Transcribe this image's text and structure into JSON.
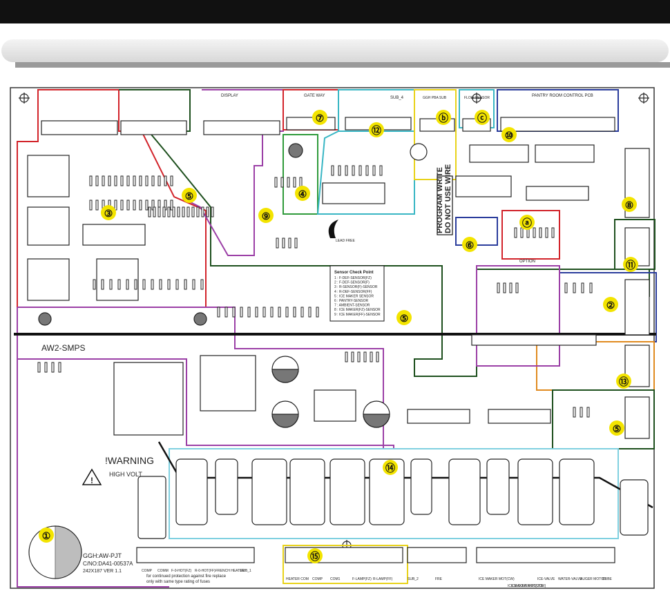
{
  "board": {
    "smps_label": "AW2-SMPS",
    "warning_title": "!WARNING",
    "warning_sub": "HIGH VOLT",
    "part_no": "GGH:AW-PJT",
    "code": "C/NO:DA41-00537A",
    "version": "242X187  VER 1.1",
    "fuse_note_1": "for continued protection against fire replace",
    "fuse_note_2": "only with same type rating of fuses",
    "program_write_1": "PROGRAM WRITE",
    "program_write_2": "DO NOT USE WIRE",
    "lead_free": "LEAD FREE",
    "option_label": "OPTION",
    "sensor_box_title": "Sensor Check Point",
    "sensor_lines": [
      "1 : F-DEF-SENSOR(FZ)",
      "2 : F-DEF-SENSOR(F)",
      "3 : R-SENSOR(F)-SENSOR",
      "4 : R-DEF-SENSOR(FF)",
      "5 : ICE MAKER SENSOR",
      "6 : PANTRY-SENSOR",
      "7 : AMBIENT-SENSOR",
      "8 : ICE MAKER(FZ)-SENSOR",
      "9 : ICE MAKER(FF)-SENSOR"
    ]
  },
  "connectors": {
    "display": "DISPLAY",
    "gate_way": "GATE WAY",
    "ggh_pba_sub": "GGH PBA SUB",
    "flow_sensor": "FLOW SENSOR",
    "pantry": "PANTRY ROOM CONTROL PCB",
    "sub_4": "SUB_4",
    "bottom": [
      "COMP",
      "COMM",
      "F-0-HOT(FZ)",
      "R-0-HOT(FF)",
      "FRENCH HEATER",
      "SUB_1",
      "HEATER COM",
      "COMP",
      "COM1",
      "F-LAMP(FZ)",
      "R-LAMP(FF)",
      "SUB_2",
      "FRE",
      "ICE MAKER MOT(CW)",
      "ICE MAKER MOT(CCW)",
      "ICE-VALVE",
      "WATER-VALVE",
      "AUGER MOTOR",
      "CUBE",
      "ICE COVER ROUTE"
    ]
  },
  "callouts": [
    {
      "id": "c1",
      "label": "①"
    },
    {
      "id": "c2",
      "label": "②"
    },
    {
      "id": "c3",
      "label": "③"
    },
    {
      "id": "c4",
      "label": "④"
    },
    {
      "id": "c5a",
      "label": "⑤"
    },
    {
      "id": "c5b",
      "label": "⑤"
    },
    {
      "id": "c5c",
      "label": "⑤"
    },
    {
      "id": "c6",
      "label": "⑥"
    },
    {
      "id": "c7",
      "label": "⑦"
    },
    {
      "id": "c8",
      "label": "⑧"
    },
    {
      "id": "c9",
      "label": "⑨"
    },
    {
      "id": "c10",
      "label": "⑩"
    },
    {
      "id": "c11",
      "label": "⑪"
    },
    {
      "id": "c12",
      "label": "⑫"
    },
    {
      "id": "c13",
      "label": "⑬"
    },
    {
      "id": "c14",
      "label": "⑭"
    },
    {
      "id": "c15",
      "label": "⑮"
    },
    {
      "id": "ca",
      "label": "ⓐ"
    },
    {
      "id": "cb",
      "label": "ⓑ"
    },
    {
      "id": "cc",
      "label": "ⓒ"
    }
  ],
  "colors": {
    "red": "#d2232a",
    "green": "#1f6b2e",
    "purple": "#9b3fa6",
    "orange": "#e08a1e",
    "yellow": "#e8d21a",
    "cyan": "#38b6c4",
    "blue": "#2a3c9c",
    "dark_green": "#1d4f1d",
    "callout_fill": "#f3e400"
  }
}
